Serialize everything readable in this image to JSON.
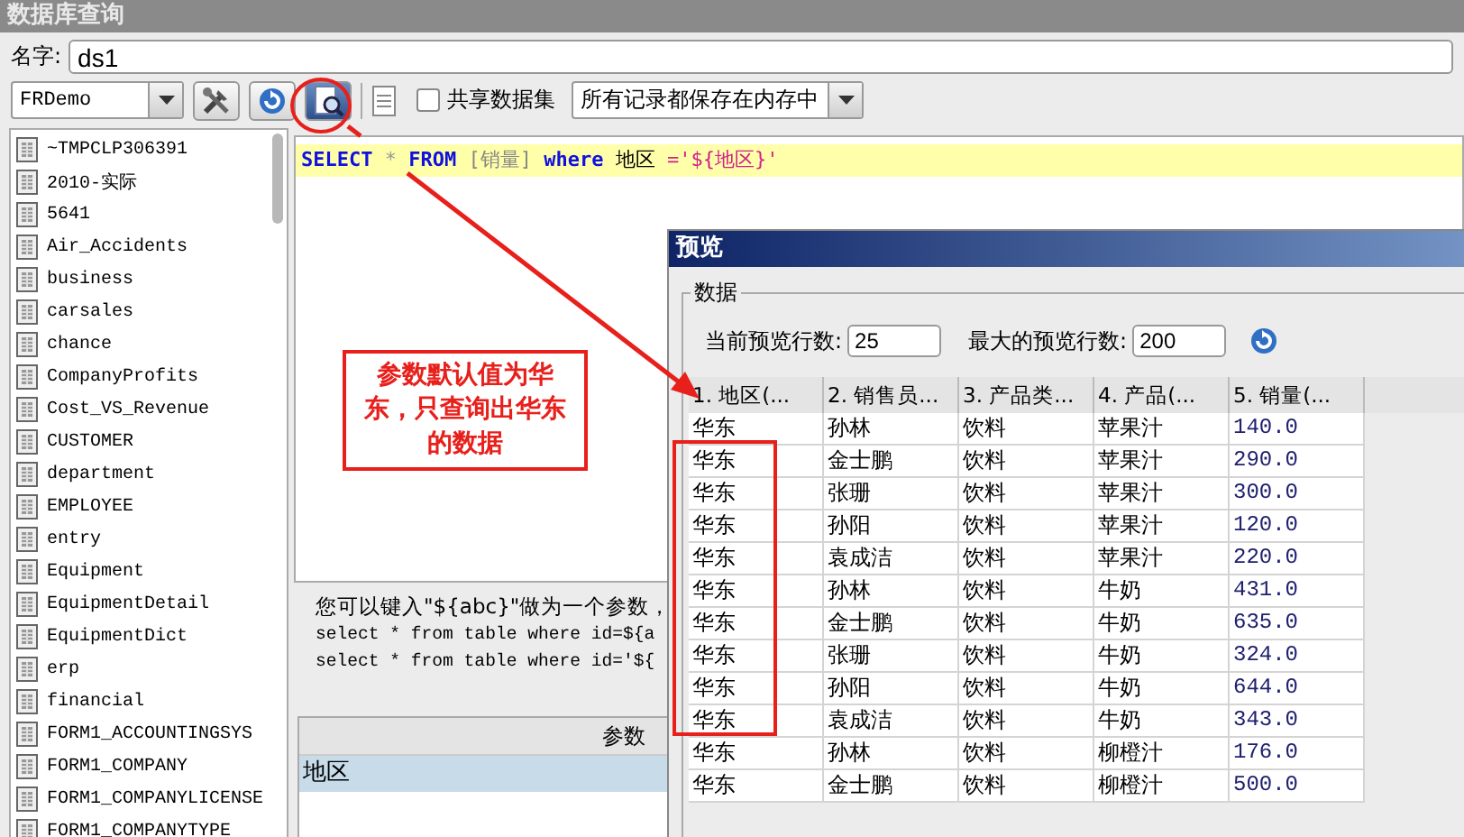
{
  "window": {
    "title": "数据库查询"
  },
  "name_field": {
    "label": "名字:",
    "value": "ds1"
  },
  "toolbar": {
    "connection": "FRDemo",
    "share_checkbox": {
      "label": "共享数据集",
      "checked": false
    },
    "storage_select": "所有记录都保存在内存中"
  },
  "tables": [
    "~TMPCLP306391",
    "2010-实际",
    "5641",
    "Air_Accidents",
    "business",
    "carsales",
    "chance",
    "CompanyProfits",
    "Cost_VS_Revenue",
    "CUSTOMER",
    "department",
    "EMPLOYEE",
    "entry",
    "Equipment",
    "EquipmentDetail",
    "EquipmentDict",
    "erp",
    "financial",
    "FORM1_ACCOUNTINGSYS",
    "FORM1_COMPANY",
    "FORM1_COMPANYLICENSE",
    "FORM1_COMPANYTYPE"
  ],
  "sql": [
    {
      "kind": "keyword",
      "text": "SELECT"
    },
    {
      "kind": "symbol",
      "text": "*"
    },
    {
      "kind": "keyword",
      "text": "FROM"
    },
    {
      "kind": "table",
      "text": "[销量]"
    },
    {
      "kind": "keyword",
      "text": "where"
    },
    {
      "kind": "plain",
      "text": "地区"
    },
    {
      "kind": "string",
      "text": "='${地区}'"
    }
  ],
  "hint": {
    "text": "您可以键入\"${abc}\"做为一个参数，",
    "examples": [
      "select * from table where id=${a",
      "select * from table where id='${"
    ]
  },
  "parameters": {
    "columns": [
      "参数"
    ],
    "rows": [
      {
        "name": "地区",
        "selected": true
      }
    ]
  },
  "preview": {
    "title": "预览",
    "group": "数据",
    "current_rows_label": "当前预览行数:",
    "current_rows": "25",
    "max_rows_label": "最大的预览行数:",
    "max_rows": "200",
    "columns": [
      "1. 地区(...",
      "2. 销售员...",
      "3. 产品类...",
      "4. 产品(...",
      "5. 销量(..."
    ],
    "rows": [
      [
        "华东",
        "孙林",
        "饮料",
        "苹果汁",
        "140.0"
      ],
      [
        "华东",
        "金士鹏",
        "饮料",
        "苹果汁",
        "290.0"
      ],
      [
        "华东",
        "张珊",
        "饮料",
        "苹果汁",
        "300.0"
      ],
      [
        "华东",
        "孙阳",
        "饮料",
        "苹果汁",
        "120.0"
      ],
      [
        "华东",
        "袁成洁",
        "饮料",
        "苹果汁",
        "220.0"
      ],
      [
        "华东",
        "孙林",
        "饮料",
        "牛奶",
        "431.0"
      ],
      [
        "华东",
        "金士鹏",
        "饮料",
        "牛奶",
        "635.0"
      ],
      [
        "华东",
        "张珊",
        "饮料",
        "牛奶",
        "324.0"
      ],
      [
        "华东",
        "孙阳",
        "饮料",
        "牛奶",
        "644.0"
      ],
      [
        "华东",
        "袁成洁",
        "饮料",
        "牛奶",
        "343.0"
      ],
      [
        "华东",
        "孙林",
        "饮料",
        "柳橙汁",
        "176.0"
      ],
      [
        "华东",
        "金士鹏",
        "饮料",
        "柳橙汁",
        "500.0"
      ]
    ]
  },
  "annotation": {
    "text": "参数默认值为华东，只查询出华东的数据"
  }
}
